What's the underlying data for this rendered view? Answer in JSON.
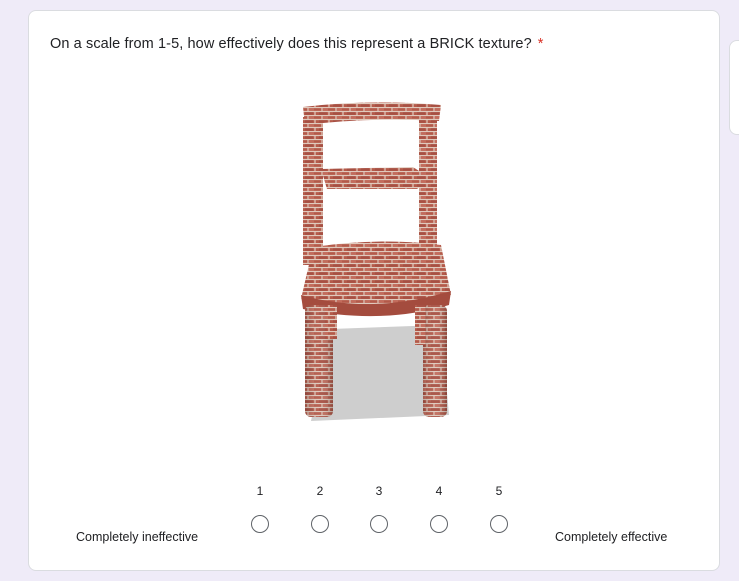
{
  "question": {
    "text": "On a scale from 1-5, how effectively does this represent a BRICK texture?",
    "required_mark": "*"
  },
  "image": {
    "subject": "brick-textured-chair",
    "colors": {
      "brick": "#b45a4a",
      "mortar": "#d9c2b5",
      "shadow": "#c8c8c8"
    }
  },
  "scale": {
    "options": [
      "1",
      "2",
      "3",
      "4",
      "5"
    ],
    "low_label": "Completely ineffective",
    "high_label": "Completely effective",
    "selected": null
  },
  "colors": {
    "background": "#efebf8",
    "required": "#d93025",
    "radio_border": "#5f6368"
  }
}
